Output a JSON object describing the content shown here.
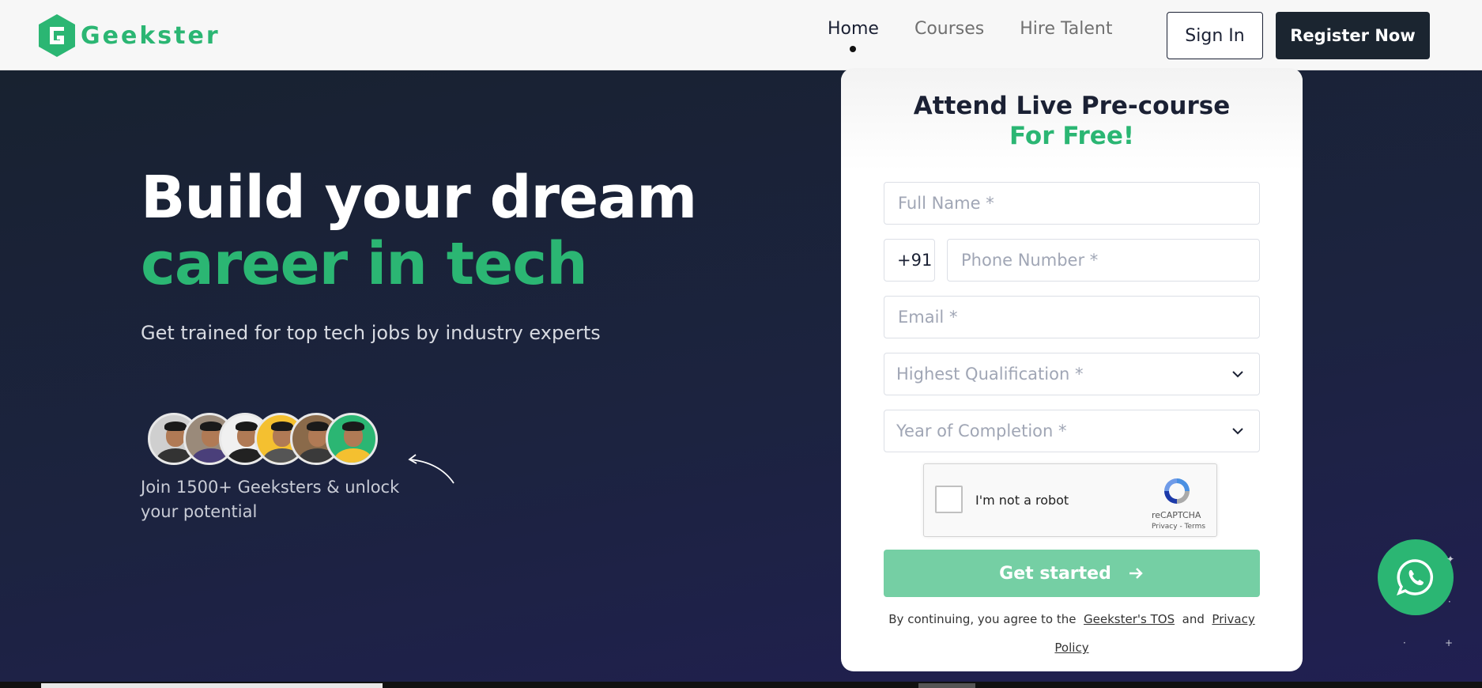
{
  "header": {
    "logo_text": "Geekster",
    "nav": [
      {
        "label": "Home",
        "active": true
      },
      {
        "label": "Courses",
        "active": false
      },
      {
        "label": "Hire Talent",
        "active": false
      }
    ],
    "signin_label": "Sign In",
    "register_label": "Register Now"
  },
  "hero": {
    "title_line1": "Build your dream",
    "title_line2": "career in tech",
    "subtitle": "Get trained for top tech jobs by industry experts",
    "join_text": "Join 1500+ Geeksters & unlock your potential"
  },
  "form": {
    "title": "Attend Live Pre-course",
    "subtitle": "For Free!",
    "full_name_placeholder": "Full Name *",
    "country_code": "+91",
    "phone_placeholder": "Phone Number *",
    "email_placeholder": "Email *",
    "qualification_placeholder": "Highest Qualification *",
    "year_placeholder": "Year of Completion *",
    "captcha": {
      "label": "I'm not a robot",
      "brand": "reCAPTCHA",
      "links": "Privacy - Terms"
    },
    "submit_label": "Get started",
    "terms_prefix": "By continuing, you agree to the",
    "terms_link": "Geekster's TOS",
    "terms_and": "and",
    "privacy_link": "Privacy Policy"
  },
  "colors": {
    "brand_green": "#2bb673",
    "dark_navy": "#1b2134",
    "button_light_green": "#75cfa4"
  },
  "icons": {
    "logo": "geekster-logo-icon",
    "chevron": "chevron-down-icon",
    "arrow": "arrow-right-icon",
    "whatsapp": "whatsapp-icon"
  }
}
